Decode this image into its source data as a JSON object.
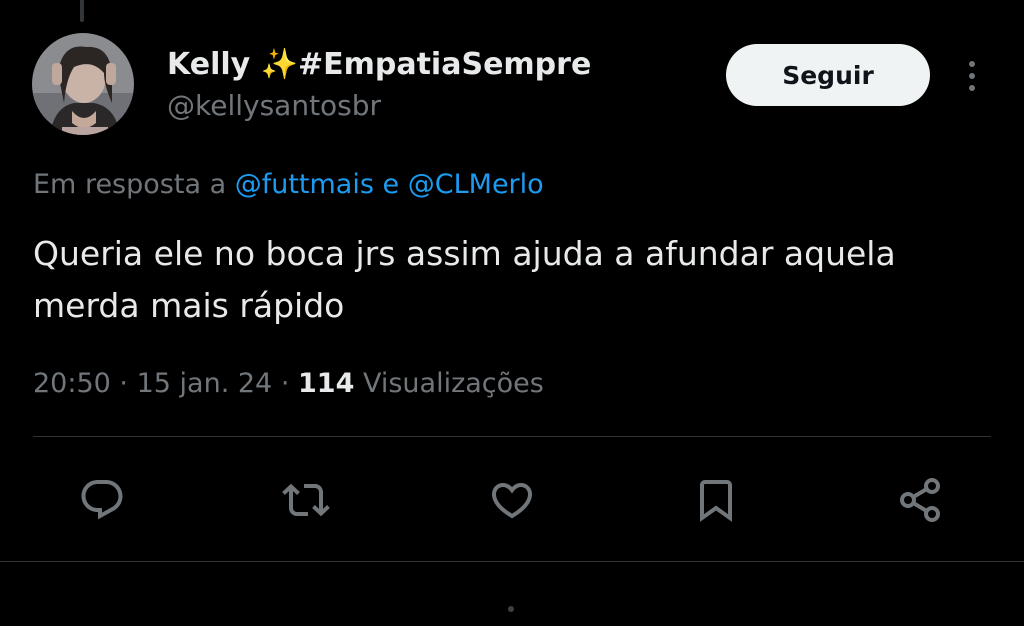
{
  "author": {
    "display_name": "Kelly ✨#EmpatiaSempre",
    "handle": "@kellysantosbr",
    "avatar": "avatar-photo"
  },
  "follow_label": "Seguir",
  "reply_context": {
    "prefix": "Em resposta a",
    "mention_1": "@futtmais",
    "conjunction": "e",
    "mention_2": "@CLMerlo"
  },
  "tweet": {
    "text": "Queria ele no boca jrs assim ajuda a afundar aquela merda mais rápido"
  },
  "meta": {
    "time": "20:50",
    "date": "15 jan. 24",
    "separator": "·",
    "views_count": "114",
    "views_label": "Visualizações"
  },
  "actions": [
    {
      "name": "reply",
      "icon": "reply-icon"
    },
    {
      "name": "retweet",
      "icon": "retweet-icon"
    },
    {
      "name": "like",
      "icon": "heart-icon"
    },
    {
      "name": "bookmark",
      "icon": "bookmark-icon"
    },
    {
      "name": "share",
      "icon": "share-icon"
    }
  ],
  "colors": {
    "background": "#000000",
    "text_primary": "#e7e9ea",
    "text_secondary": "#71767b",
    "accent": "#1d9bf0",
    "follow_button_bg": "#eff3f4",
    "divider": "#2f3336"
  }
}
